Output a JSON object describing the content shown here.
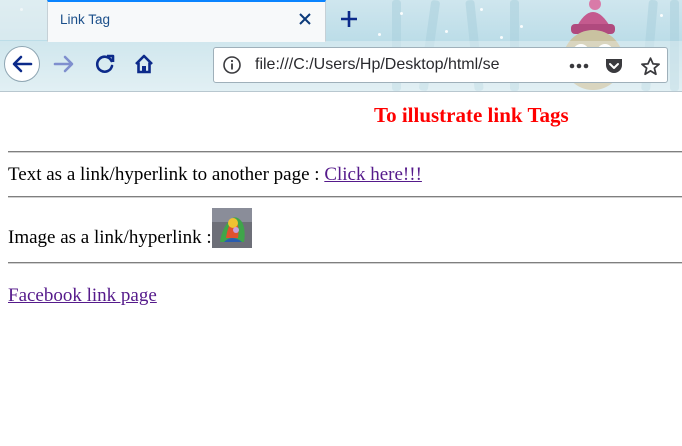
{
  "browser": {
    "tab_title": "Link Tag",
    "url": "file:///C:/Users/Hp/Desktop/html/se",
    "icons": {
      "close": "close-icon",
      "new_tab": "plus-icon",
      "back": "back-arrow-icon",
      "forward": "forward-arrow-icon",
      "reload": "reload-icon",
      "home": "home-icon",
      "info": "info-icon",
      "more": "more-dots-icon",
      "pocket": "pocket-icon",
      "bookmark": "star-icon"
    },
    "accent_color": "#0a84ff"
  },
  "page": {
    "heading": "To illustrate link Tags",
    "heading_color": "#ff0000",
    "text_link_line": {
      "label": "Text as a link/hyperlink to another page : ",
      "link_text": "Click here!!!"
    },
    "image_link_line": {
      "label": "Image as a link/hyperlink :"
    },
    "facebook_link": "Facebook link page",
    "link_color": "#551a8b"
  }
}
